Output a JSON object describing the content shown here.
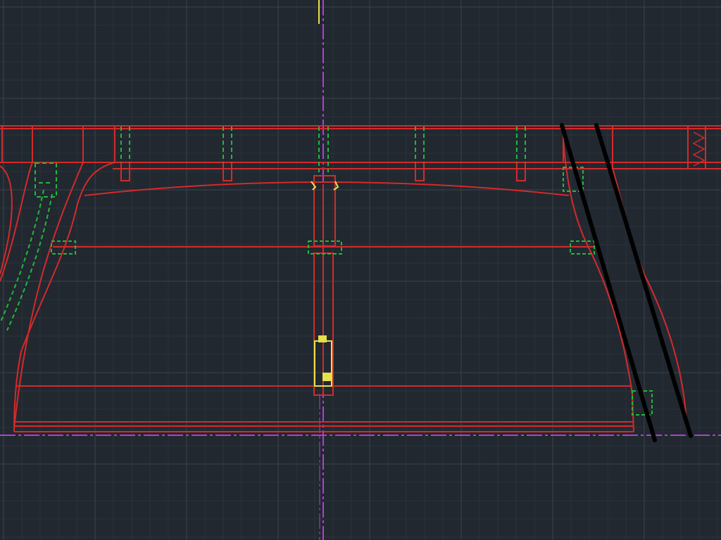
{
  "viewport": {
    "background": "#212830",
    "grid_minor_color": "#2b333c",
    "grid_major_color": "#3a4450",
    "grid_visible": true
  },
  "layers": {
    "outline_color": "#d42a2a",
    "hidden_color": "#22b83a",
    "axis_color": "#b040d0",
    "highlight_color": "#e6e04a",
    "markup_color": "#000000"
  },
  "drawing": {
    "title": ""
  }
}
